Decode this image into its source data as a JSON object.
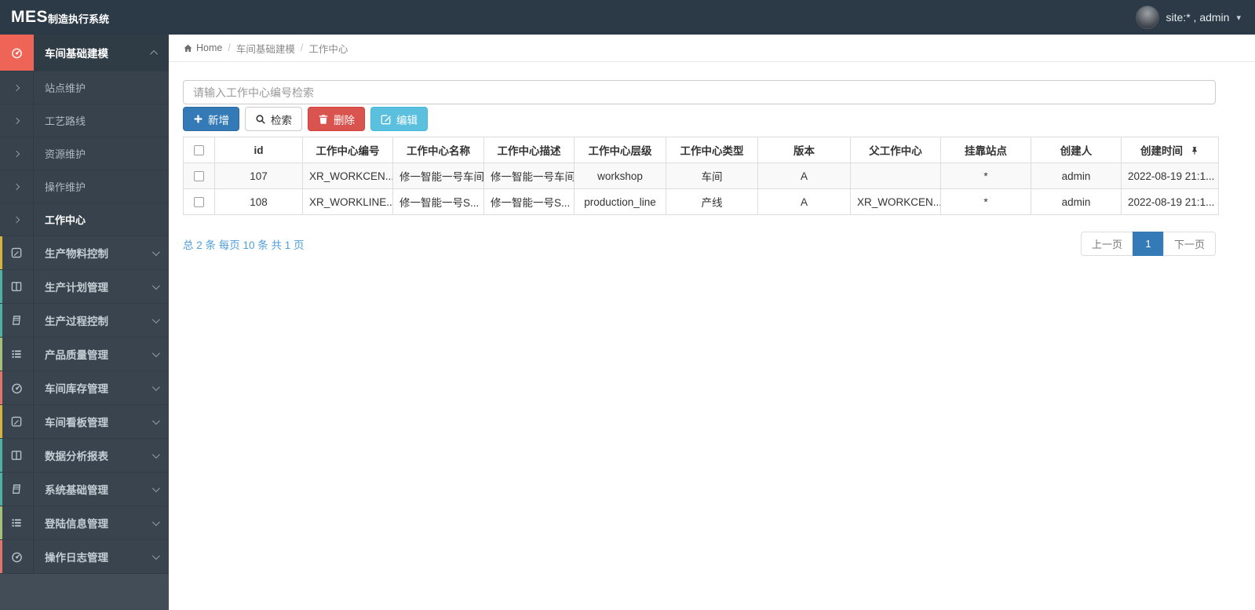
{
  "navbar": {
    "logo_bold": "MES",
    "logo_rest": "制造执行系统",
    "user_label": "site:* , admin"
  },
  "breadcrumb": {
    "home": "Home",
    "items": [
      "车间基础建模",
      "工作中心"
    ]
  },
  "sidebar": {
    "active_section": {
      "label": "车间基础建模",
      "icon": "gauge-icon",
      "accent": "#ee6456",
      "children": [
        {
          "label": "站点维护",
          "active": false
        },
        {
          "label": "工艺路线",
          "active": false
        },
        {
          "label": "资源维护",
          "active": false
        },
        {
          "label": "操作维护",
          "active": false
        },
        {
          "label": "工作中心",
          "active": true
        }
      ]
    },
    "sections": [
      {
        "label": "生产物料控制",
        "icon": "pencil-icon",
        "accent": "#d9b43c"
      },
      {
        "label": "生产计划管理",
        "icon": "columns-icon",
        "accent": "#4cb2a2"
      },
      {
        "label": "生产过程控制",
        "icon": "book-icon",
        "accent": "#4cb2a2"
      },
      {
        "label": "产品质量管理",
        "icon": "list-icon",
        "accent": "#a3c178"
      },
      {
        "label": "车间库存管理",
        "icon": "gauge-icon",
        "accent": "#e4736b"
      },
      {
        "label": "车间看板管理",
        "icon": "pencil-icon",
        "accent": "#d9b43c"
      },
      {
        "label": "数据分析报表",
        "icon": "columns-icon",
        "accent": "#4cb2a2"
      },
      {
        "label": "系统基础管理",
        "icon": "book-icon",
        "accent": "#4cb2a2"
      },
      {
        "label": "登陆信息管理",
        "icon": "list-icon",
        "accent": "#a3c178"
      },
      {
        "label": "操作日志管理",
        "icon": "gauge-icon",
        "accent": "#e4736b"
      }
    ]
  },
  "toolbar": {
    "search_placeholder": "请输入工作中心编号检索",
    "buttons": [
      {
        "label": "新增",
        "icon": "plus-icon",
        "style": "primary"
      },
      {
        "label": "检索",
        "icon": "search-icon",
        "style": "default"
      },
      {
        "label": "删除",
        "icon": "trash-icon",
        "style": "danger"
      },
      {
        "label": "编辑",
        "icon": "edit-icon",
        "style": "info"
      }
    ]
  },
  "table": {
    "columns": [
      "id",
      "工作中心编号",
      "工作中心名称",
      "工作中心描述",
      "工作中心层级",
      "工作中心类型",
      "版本",
      "父工作中心",
      "挂靠站点",
      "创建人",
      "创建时间"
    ],
    "rows": [
      [
        "107",
        "XR_WORKCEN...",
        "修一智能一号车间",
        "修一智能一号车间",
        "workshop",
        "车间",
        "A",
        "",
        "*",
        "admin",
        "2022-08-19 21:1..."
      ],
      [
        "108",
        "XR_WORKLINE...",
        "修一智能一号S...",
        "修一智能一号S...",
        "production_line",
        "产线",
        "A",
        "XR_WORKCEN...",
        "*",
        "admin",
        "2022-08-19 21:1..."
      ]
    ]
  },
  "pagination": {
    "summary": "总 2 条 每页 10 条 共 1 页",
    "prev": "上一页",
    "page": "1",
    "next": "下一页"
  },
  "colors": {
    "navbar_bg": "#2b3a46",
    "sidebar_bg": "#424d57",
    "sidebar_item_bg": "#39444e",
    "active_icon_red": "#ee6456",
    "primary_blue": "#337ab7",
    "danger_red": "#d9534f",
    "info_cyan": "#5bc0de",
    "summary_blue": "#4f9dd9",
    "accent_yellow": "#d9b43c",
    "accent_teal": "#4cb2a2",
    "accent_green": "#a3c178",
    "accent_red": "#e4736b"
  }
}
